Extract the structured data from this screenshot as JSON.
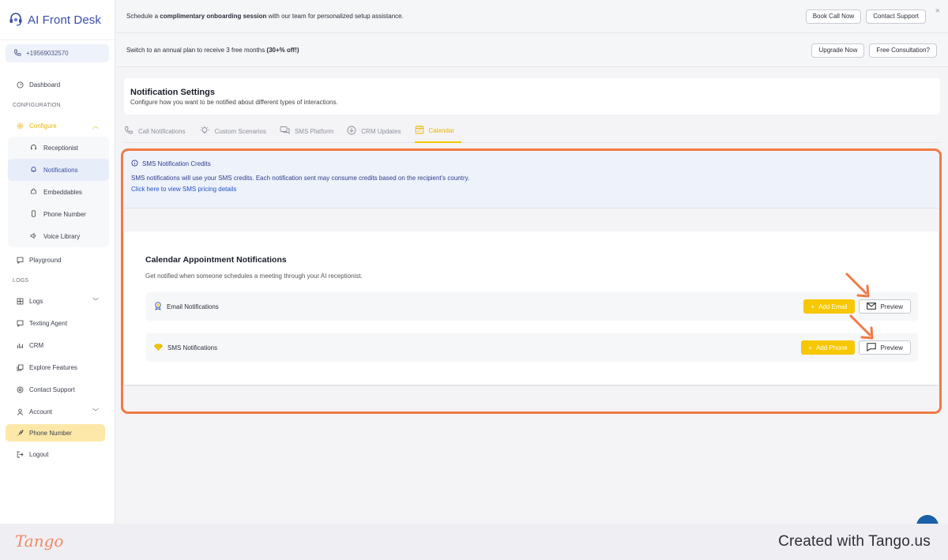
{
  "app": {
    "name": "AI Front Desk",
    "phone": "+19569032570"
  },
  "sidebar": {
    "dashboard": "Dashboard",
    "section_config": "CONFIGURATION",
    "configure": "Configure",
    "sub": [
      "Receptionist",
      "Notifications",
      "Embeddables",
      "Phone Number",
      "Voice Library"
    ],
    "playground": "Playground",
    "section_logs": "LOGS",
    "logs": "Logs",
    "texting_agent": "Texting Agent",
    "crm": "CRM",
    "explore": "Explore Features",
    "contact_support": "Contact Support",
    "account": "Account",
    "phone_number": "Phone Number",
    "logout": "Logout"
  },
  "banner1": {
    "pre": "Schedule a ",
    "bold": "complimentary onboarding session",
    "post": " with our team for personalized setup assistance.",
    "btn1": "Book Call Now",
    "btn2": "Contact Support",
    "close": "×"
  },
  "banner2": {
    "pre": "Switch to an annual plan to receive 3 free months ",
    "bold": "(30+% off!)",
    "btn1": "Upgrade Now",
    "btn2": "Free Consultation?"
  },
  "page": {
    "title": "Notification Settings",
    "subtitle": "Configure how you want to be notified about different types of interactions."
  },
  "tabs": [
    "Call Notifications",
    "Custom Scenarios",
    "SMS Platform",
    "CRM Updates",
    "Calendar"
  ],
  "credits": {
    "title": "SMS Notification Credits",
    "desc": "SMS notifications will use your SMS credits. Each notification sent may consume credits based on the recipient's country.",
    "link": "Click here to view SMS pricing details"
  },
  "calendar": {
    "title": "Calendar Appointment Notifications",
    "subtitle": "Get notified when someone schedules a meeting through your AI receptionist.",
    "email_label": "Email Notifications",
    "add_email": "Add Email",
    "sms_label": "SMS Notifications",
    "add_phone": "Add Phone",
    "preview": "Preview"
  },
  "footer": {
    "brand": "Tango",
    "created": "Created with Tango.us"
  },
  "colors": {
    "accent": "#f5c800",
    "highlight": "#f07a45",
    "brand_blue": "#3a4da8"
  }
}
